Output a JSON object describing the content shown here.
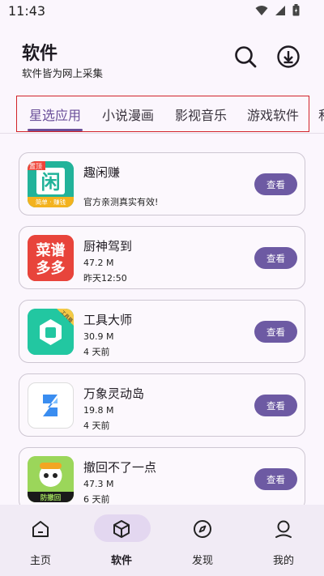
{
  "status": {
    "time": "11:43"
  },
  "header": {
    "title": "软件",
    "subtitle": "软件皆为网上采集",
    "search_icon": "search-icon",
    "download_icon": "download-icon"
  },
  "tabs": [
    {
      "label": "星选应用",
      "active": true
    },
    {
      "label": "小说漫画"
    },
    {
      "label": "影视音乐"
    },
    {
      "label": "游戏软件"
    },
    {
      "label": "私"
    }
  ],
  "apps": [
    {
      "name": "趣闲赚",
      "lines": [
        "官方亲测真实有效!"
      ],
      "button": "查看",
      "icon": "quxianzhuan-icon",
      "icon_text": "闲",
      "badge": "置顶",
      "tagline": "简单 · 赚钱"
    },
    {
      "name": "厨神驾到",
      "lines": [
        "47.2 M",
        "昨天12:50"
      ],
      "button": "查看",
      "icon": "caipu-duoduo-icon",
      "icon_text": "菜谱多多"
    },
    {
      "name": "工具大师",
      "lines": [
        "30.9 M",
        "4 天前"
      ],
      "button": "查看",
      "icon": "tool-master-icon",
      "badge": "工具箱"
    },
    {
      "name": "万象灵动岛",
      "lines": [
        "19.8 M",
        "4 天前"
      ],
      "button": "查看",
      "icon": "dynamic-island-icon"
    },
    {
      "name": "撤回不了一点",
      "lines": [
        "47.3 M",
        "6 天前"
      ],
      "button": "查看",
      "icon": "anti-recall-icon",
      "icon_text": "防撤回"
    }
  ],
  "nav": [
    {
      "label": "主页",
      "icon": "home-icon"
    },
    {
      "label": "软件",
      "icon": "box-icon",
      "active": true
    },
    {
      "label": "发现",
      "icon": "compass-icon"
    },
    {
      "label": "我的",
      "icon": "profile-icon"
    }
  ],
  "colors": {
    "accent": "#6d5aa3",
    "highlight_box": "#d2232a",
    "background": "#fbf6fd"
  }
}
